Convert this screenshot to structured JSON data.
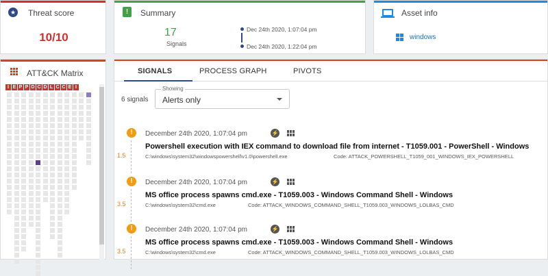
{
  "threat": {
    "title": "Threat score",
    "score": "10/10",
    "icon": "star-icon"
  },
  "summary": {
    "title": "Summary",
    "icon": "badge-icon",
    "signal_count": "17",
    "signal_label": "Signals",
    "first_seen": "Dec 24th 2020, 1:07:04 pm",
    "last_seen": "Dec 24th 2020, 1:22:04 pm"
  },
  "asset": {
    "title": "Asset info",
    "icon": "monitor-icon",
    "os": "windows",
    "os_icon": "windows-icon"
  },
  "attack": {
    "title": "ATT&CK Matrix",
    "icon": "grid-icon",
    "tactics": [
      "I",
      "E",
      "P",
      "P",
      "D",
      "C",
      "D",
      "L",
      "C",
      "C",
      "E",
      "I"
    ]
  },
  "tabs": [
    "SIGNALS",
    "PROCESS GRAPH",
    "PIVOTS"
  ],
  "filter": {
    "count_label": "6 signals",
    "legend": "Showing",
    "value": "Alerts only"
  },
  "signals": [
    {
      "date": "December 24th 2020, 1:07:04 pm",
      "title": "Powershell execution with IEX command to download file from internet - T1059.001 - PowerShell - Windows",
      "path": "C:\\windows\\system32\\windowspowershell\\v1.0\\powershell.exe",
      "code": "Code: ATTACK_POWERSHELL_T1059_001_WINDOWS_IEX_POWERSHELL",
      "level": "1.5"
    },
    {
      "date": "December 24th 2020, 1:07:04 pm",
      "title": "MS office process spawns cmd.exe - T1059.003 - Windows Command Shell - Windows",
      "path": "C:\\windows\\system32\\cmd.exe",
      "code": "Code: ATTACK_WINDOWS_COMMAND_SHELL_T1059.003_WINDOWS_LOLBAS_CMD",
      "level": "3.5"
    },
    {
      "date": "December 24th 2020, 1:07:04 pm",
      "title": "MS office process spawns cmd.exe - T1059.003 - Windows Command Shell - Windows",
      "path": "C:\\windows\\system32\\cmd.exe",
      "code": "Code: ATTACK_WINDOWS_COMMAND_SHELL_T1059.003_WINDOWS_LOLBAS_CMD",
      "level": "3.5"
    }
  ],
  "colors": {
    "threat": "#d32f2f",
    "summary": "#43a047",
    "asset": "#1e88e5",
    "attack": "#d84315",
    "warning": "#f39c12"
  }
}
